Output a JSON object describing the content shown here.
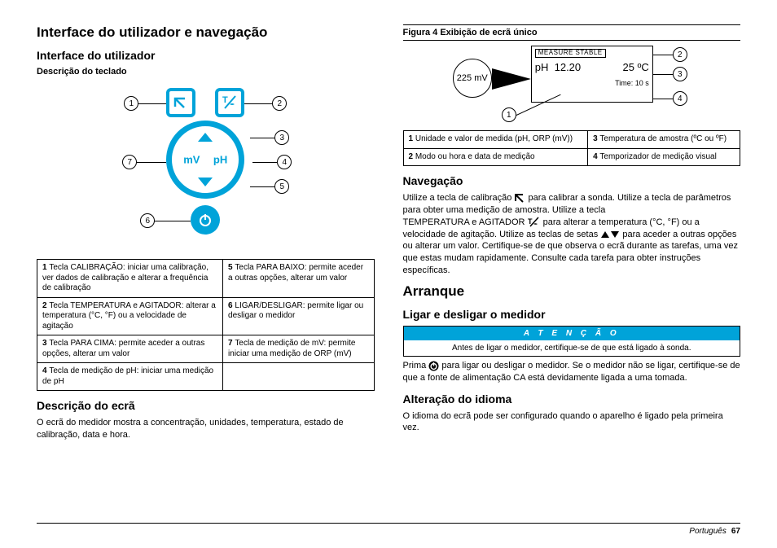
{
  "left": {
    "h1": "Interface do utilizador e navegação",
    "h2a": "Interface do utilizador",
    "h3a": "Descrição do teclado",
    "keypad": {
      "mv": "mV",
      "ph": "pH",
      "callouts": [
        "1",
        "2",
        "3",
        "4",
        "5",
        "6",
        "7"
      ]
    },
    "keypad_table": [
      [
        "1",
        "Tecla CALIBRAÇÃO: iniciar uma calibração, ver dados de calibração e alterar a frequência de calibração",
        "5",
        "Tecla PARA BAIXO: permite aceder a outras opções, alterar um valor"
      ],
      [
        "2",
        "Tecla TEMPERATURA e AGITADOR: alterar a temperatura (°C, °F) ou a velocidade de agitação",
        "6",
        "LIGAR/DESLIGAR: permite ligar ou desligar o medidor"
      ],
      [
        "3",
        "Tecla PARA CIMA: permite aceder a outras opções, alterar um valor",
        "7",
        "Tecla de medição de mV: permite iniciar uma medição de ORP (mV)"
      ],
      [
        "4",
        "Tecla de medição de pH: iniciar uma medição de pH",
        "",
        ""
      ]
    ],
    "h2b": "Descrição do ecrã",
    "p_screen": "O ecrã do medidor mostra a concentração, unidades, temperatura, estado de calibração, data e hora."
  },
  "right": {
    "fig_caption": "Figura 4  Exibição de ecrã único",
    "display": {
      "mv": "225 mV",
      "stable": "MEASURE STABLE",
      "ph_lbl": "pH",
      "ph_val": "12.20",
      "temp": "25 ºC",
      "time": "Time:  10  s",
      "callouts": [
        "1",
        "2",
        "3",
        "4"
      ]
    },
    "display_table": [
      [
        "1",
        "Unidade e valor de medida (pH, ORP (mV))",
        "3",
        "Temperatura de amostra (ºC ou ºF)"
      ],
      [
        "2",
        "Modo ou hora e data de medição",
        "4",
        "Temporizador de medição visual"
      ]
    ],
    "h2_nav": "Navegação",
    "nav_p1a": "Utilize a tecla de calibração",
    "nav_p1b": "para calibrar a sonda. Utilize a tecla de parâmetros para obter uma medição de amostra. Utilize a tecla",
    "nav_p2a": "TEMPERATURA e AGITADOR",
    "nav_p2b": "para alterar a temperatura (°C, °F) ou a velocidade de agitação. Utilize as teclas de setas",
    "nav_p2c": "para aceder a outras opções ou alterar um valor. Certifique-se de que observa o ecrã durante as tarefas, uma vez que estas mudam rapidamente. Consulte cada tarefa para obter instruções específicas.",
    "h1_start": "Arranque",
    "h2_on": "Ligar e desligar o medidor",
    "warn_hd": "A T E N Ç Ã O",
    "warn_bd": "Antes de ligar o medidor, certifique-se de que está ligado à sonda.",
    "on_p_a": "Prima",
    "on_p_b": "para ligar ou desligar o medidor. Se o medidor não se ligar, certifique-se de que a fonte de alimentação CA está devidamente ligada a uma tomada.",
    "h2_lang": "Alteração do idioma",
    "lang_p": "O idioma do ecrã pode ser configurado quando o aparelho é ligado pela primeira vez."
  },
  "footer": {
    "lang": "Português",
    "page": "67"
  }
}
